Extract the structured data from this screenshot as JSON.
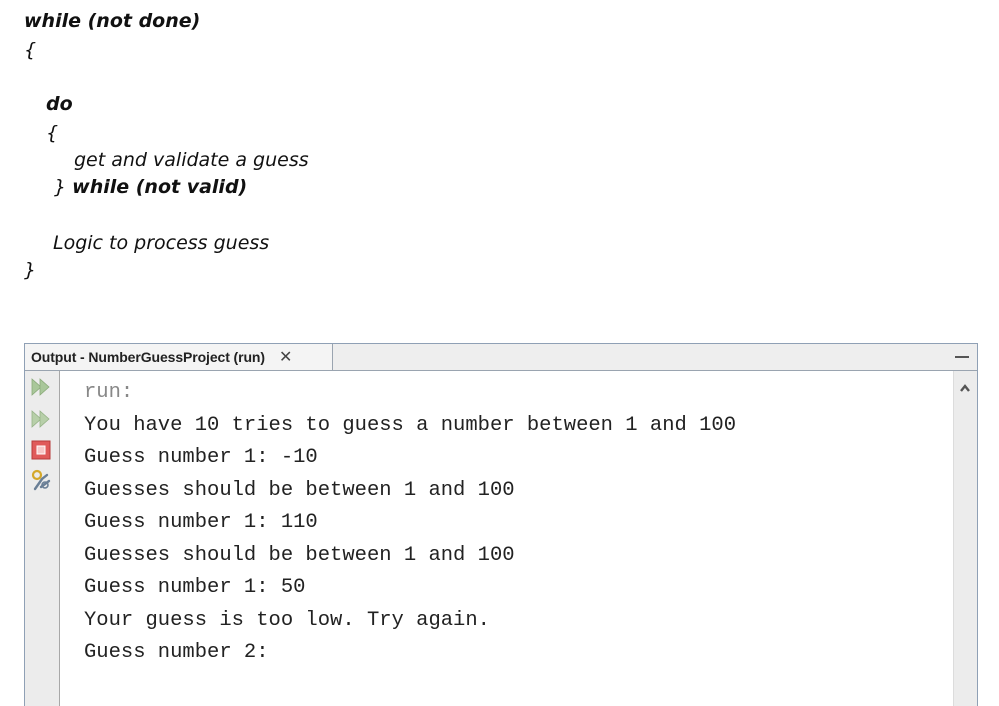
{
  "pseudocode": {
    "lines": [
      {
        "text": "while (not done)",
        "style": "bold"
      },
      {
        "text": "{",
        "style": "normal"
      },
      {
        "text": "do",
        "style": "bold"
      },
      {
        "text": "{",
        "style": "normal"
      },
      {
        "text": "get and validate a guess",
        "style": "normal"
      },
      {
        "brace": "}",
        "text": "while (not valid)",
        "style": "mixed"
      },
      {
        "text": "Logic to process guess",
        "style": "normal"
      },
      {
        "text": "}",
        "style": "normal"
      }
    ]
  },
  "output_panel": {
    "tab_title": "Output - NumberGuessProject (run)",
    "close_glyph": "✕",
    "gutter_icons": [
      "rerun-icon",
      "rerun-with-options-icon",
      "stop-icon",
      "settings-icon"
    ],
    "colors": {
      "rerun_green": "#a9c79a",
      "stop_red": "#e05a5a",
      "border": "#8fa0b5"
    },
    "console_lines": [
      {
        "text": "run:",
        "muted": true
      },
      {
        "text": "You have 10 tries to guess a number between 1 and 100",
        "muted": false
      },
      {
        "text": "Guess number 1: -10",
        "muted": false
      },
      {
        "text": "Guesses should be between 1 and 100",
        "muted": false
      },
      {
        "text": "Guess number 1: 110",
        "muted": false
      },
      {
        "text": "Guesses should be between 1 and 100",
        "muted": false
      },
      {
        "text": "Guess number 1: 50",
        "muted": false
      },
      {
        "text": "Your guess is too low. Try again.",
        "muted": false
      },
      {
        "text": "Guess number 2:",
        "muted": false
      }
    ]
  }
}
